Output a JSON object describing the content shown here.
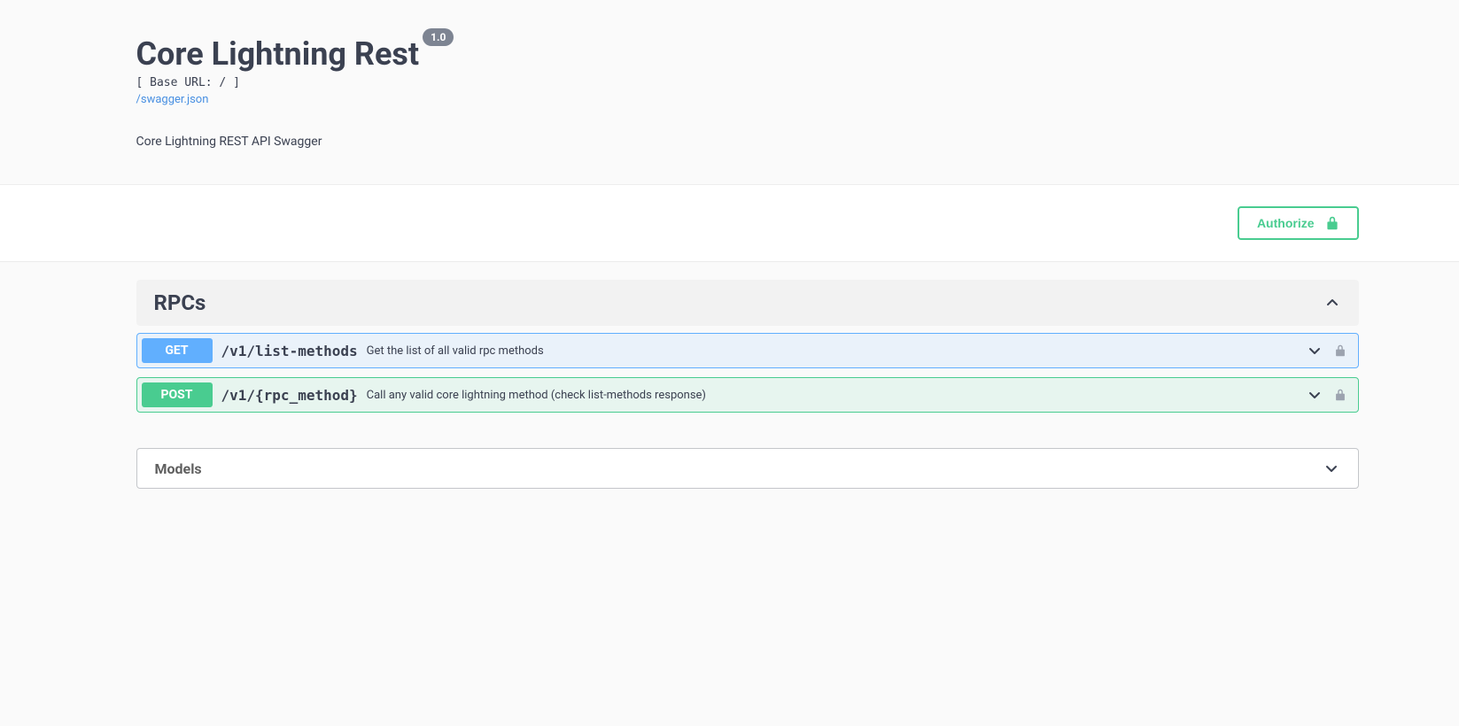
{
  "header": {
    "title": "Core Lightning Rest",
    "version": "1.0",
    "baseUrl": "[ Base URL: / ]",
    "swaggerLink": "/swagger.json",
    "description": "Core Lightning REST API Swagger"
  },
  "auth": {
    "authorizeLabel": "Authorize"
  },
  "tags": {
    "rpcs": {
      "name": "RPCs"
    }
  },
  "operations": {
    "get1": {
      "method": "GET",
      "path": "/v1/list-methods",
      "description": "Get the list of all valid rpc methods"
    },
    "post1": {
      "method": "POST",
      "path": "/v1/{rpc_method}",
      "description": "Call any valid core lightning method (check list-methods response)"
    }
  },
  "models": {
    "title": "Models"
  }
}
